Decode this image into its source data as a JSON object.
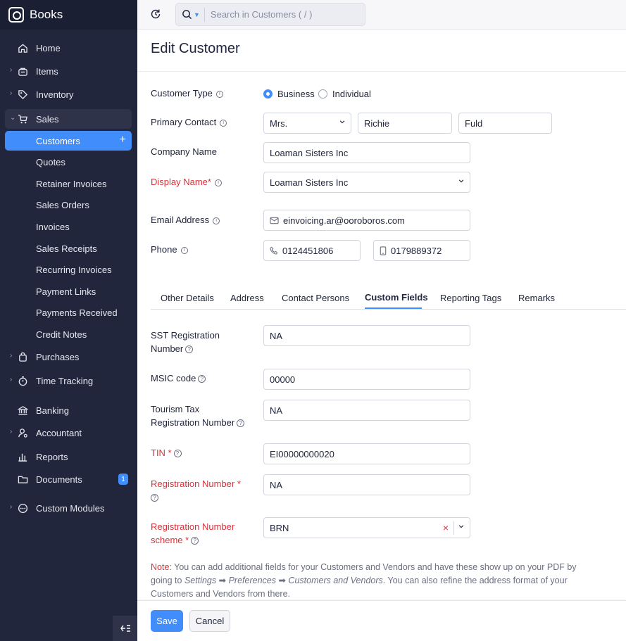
{
  "app": {
    "name": "Books"
  },
  "sidebar": {
    "items": [
      {
        "label": "Home"
      },
      {
        "label": "Items"
      },
      {
        "label": "Inventory"
      },
      {
        "label": "Sales"
      },
      {
        "label": "Customers"
      },
      {
        "label": "Quotes"
      },
      {
        "label": "Retainer Invoices"
      },
      {
        "label": "Sales Orders"
      },
      {
        "label": "Invoices"
      },
      {
        "label": "Sales Receipts"
      },
      {
        "label": "Recurring Invoices"
      },
      {
        "label": "Payment Links"
      },
      {
        "label": "Payments Received"
      },
      {
        "label": "Credit Notes"
      },
      {
        "label": "Purchases"
      },
      {
        "label": "Time Tracking"
      },
      {
        "label": "Banking"
      },
      {
        "label": "Accountant"
      },
      {
        "label": "Reports"
      },
      {
        "label": "Documents",
        "badge": "1"
      },
      {
        "label": "Custom Modules"
      }
    ]
  },
  "search": {
    "placeholder": "Search in Customers ( / )"
  },
  "page": {
    "title": "Edit Customer"
  },
  "form": {
    "customer_type": {
      "label": "Customer Type",
      "options": [
        "Business",
        "Individual"
      ],
      "selected": "Business"
    },
    "primary_contact": {
      "label": "Primary Contact",
      "salutation": "Mrs.",
      "first_name": "Richie",
      "last_name": "Fuld"
    },
    "company_name": {
      "label": "Company Name",
      "value": "Loaman Sisters Inc"
    },
    "display_name": {
      "label": "Display Name*",
      "value": "Loaman Sisters Inc"
    },
    "email": {
      "label": "Email Address",
      "value": "einvoicing.ar@ooroboros.com"
    },
    "phone": {
      "label": "Phone",
      "work": "0124451806",
      "mobile": "0179889372"
    }
  },
  "tabs": [
    {
      "label": "Other Details"
    },
    {
      "label": "Address"
    },
    {
      "label": "Contact Persons"
    },
    {
      "label": "Custom Fields",
      "active": true
    },
    {
      "label": "Reporting Tags"
    },
    {
      "label": "Remarks"
    }
  ],
  "custom_fields": {
    "sst": {
      "label_line1": "SST Registration",
      "label_line2": "Number",
      "value": "NA"
    },
    "msic": {
      "label": "MSIC code",
      "value": "00000"
    },
    "tourism": {
      "label_line1": "Tourism Tax",
      "label_line2": "Registration Number",
      "value": "NA"
    },
    "tin": {
      "label": "TIN *",
      "value": "EI00000000020"
    },
    "reg_number": {
      "label": "Registration Number *",
      "value": "NA"
    },
    "reg_scheme": {
      "label_line1": "Registration Number",
      "label_line2": "scheme *",
      "value": "BRN"
    }
  },
  "note": {
    "label": "Note:",
    "text1": " You can add additional fields for your Customers and Vendors and have these show up on your PDF by going to ",
    "path1": "Settings",
    "path2": "Preferences",
    "path3": "Customers and Vendors",
    "text2": ". You can also refine the address format of your Customers and Vendors from there."
  },
  "footer": {
    "save_label": "Save",
    "cancel_label": "Cancel"
  },
  "colors": {
    "accent": "#408dfb",
    "sidebar_bg": "#21263c",
    "required": "#d6323a"
  }
}
